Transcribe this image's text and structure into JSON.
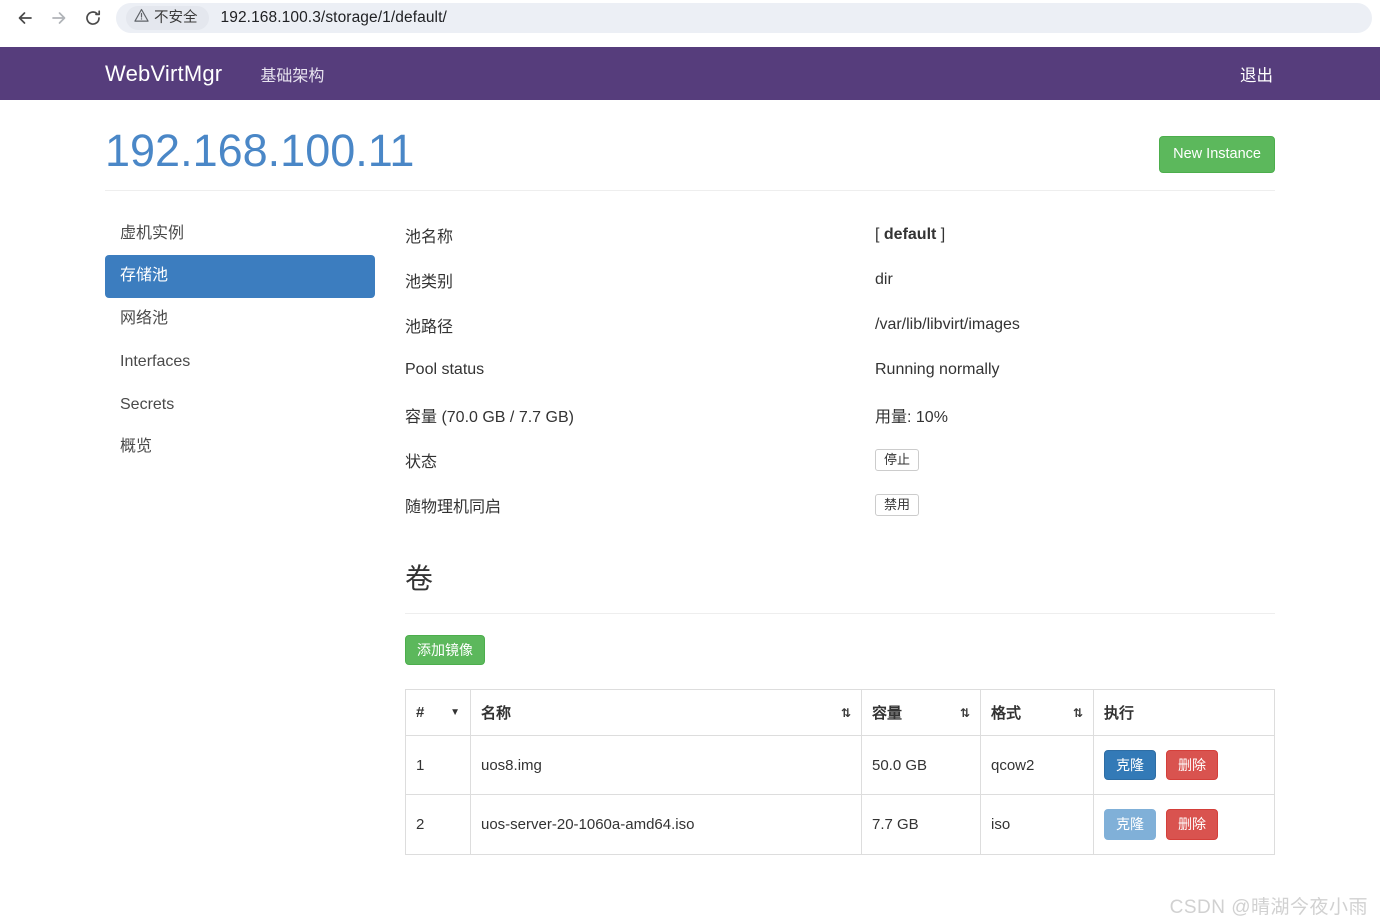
{
  "browser": {
    "back_icon": "arrow-left-icon",
    "forward_icon": "arrow-right-icon",
    "reload_icon": "reload-icon",
    "security_icon": "warning-triangle-icon",
    "security_label": "不安全",
    "url": "192.168.100.3/storage/1/default/"
  },
  "navbar": {
    "brand": "WebVirtMgr",
    "links": [
      {
        "label": "基础架构",
        "name": "nav-link-infrastructure"
      }
    ],
    "logout_label": "退出",
    "background_color": "#563d7c"
  },
  "page": {
    "title": "192.168.100.11",
    "title_color": "#4a87c7",
    "new_instance_label": "New Instance",
    "new_instance_color": "#5cb85c"
  },
  "sidebar": {
    "items": [
      {
        "label": "虚机实例",
        "name": "sidebar-item-instances",
        "active": false
      },
      {
        "label": "存储池",
        "name": "sidebar-item-storage-pools",
        "active": true
      },
      {
        "label": "网络池",
        "name": "sidebar-item-network-pools",
        "active": false
      },
      {
        "label": "Interfaces",
        "name": "sidebar-item-interfaces",
        "active": false
      },
      {
        "label": "Secrets",
        "name": "sidebar-item-secrets",
        "active": false
      },
      {
        "label": "概览",
        "name": "sidebar-item-overview",
        "active": false
      }
    ],
    "active_color": "#3c7dbf"
  },
  "pool": {
    "rows": [
      {
        "label": "池名称",
        "value_prefix": "[ ",
        "value_bold": "default",
        "value_suffix": " ]"
      },
      {
        "label": "池类别",
        "value": "dir"
      },
      {
        "label": "池路径",
        "value": "/var/lib/libvirt/images"
      },
      {
        "label": "Pool status",
        "value": "Running normally"
      }
    ],
    "name_label": "池名称",
    "name_value_open": "[ ",
    "name_value_bold": "default",
    "name_value_close": " ]",
    "type_label": "池类别",
    "type_value": "dir",
    "path_label": "池路径",
    "path_value": "/var/lib/libvirt/images",
    "status_label": "Pool status",
    "status_value": "Running normally",
    "capacity_label": "容量 (70.0 GB / 7.7 GB)",
    "capacity_value": "用量: 10%",
    "state_label": "状态",
    "state_button": "停止",
    "autostart_label": "随物理机同启",
    "autostart_button": "禁用"
  },
  "volumes": {
    "section_title": "卷",
    "add_image_label": "添加镜像",
    "columns": {
      "index": "#",
      "name": "名称",
      "capacity": "容量",
      "format": "格式",
      "actions": "执行"
    },
    "sort_caret": "▼",
    "sort_both": "⇅",
    "rows": [
      {
        "index": "1",
        "name": "uos8.img",
        "capacity": "50.0 GB",
        "format": "qcow2",
        "clone_label": "克隆",
        "delete_label": "删除",
        "clone_muted": false
      },
      {
        "index": "2",
        "name": "uos-server-20-1060a-amd64.iso",
        "capacity": "7.7 GB",
        "format": "iso",
        "clone_label": "克隆",
        "delete_label": "删除",
        "clone_muted": true
      }
    ]
  },
  "watermark": "CSDN @晴湖今夜小雨"
}
